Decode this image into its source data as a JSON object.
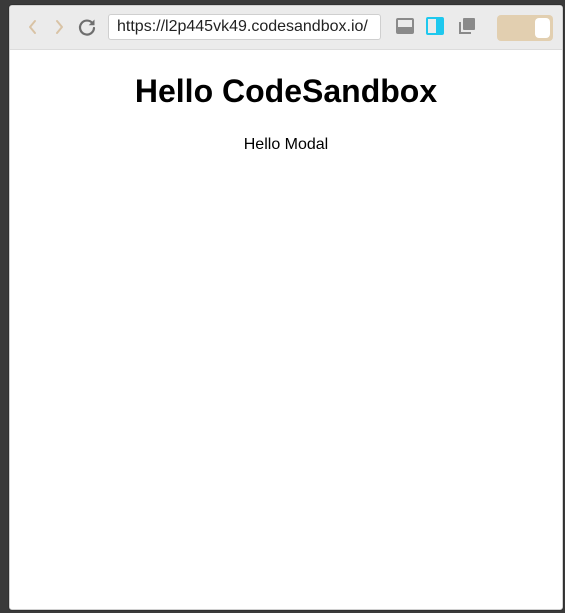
{
  "toolbar": {
    "icons": {
      "back": "chevron-left-icon",
      "forward": "chevron-right-icon",
      "reload": "reload-icon",
      "layout_bottom": "layout-bottom-icon",
      "layout_side": "layout-side-icon",
      "new_window": "new-window-icon"
    },
    "url": "https://l2p445vk49.codesandbox.io/",
    "toggle_on": true,
    "colors": {
      "chevron": "#d9c3a5",
      "reload": "#6e6e6e",
      "layout_icon": "#8a8a8a",
      "layout_side_active": "#1ec8ee",
      "toggle_bg": "#e2cfb0"
    }
  },
  "page": {
    "title": "Hello CodeSandbox",
    "link_text": "Hello Modal"
  }
}
